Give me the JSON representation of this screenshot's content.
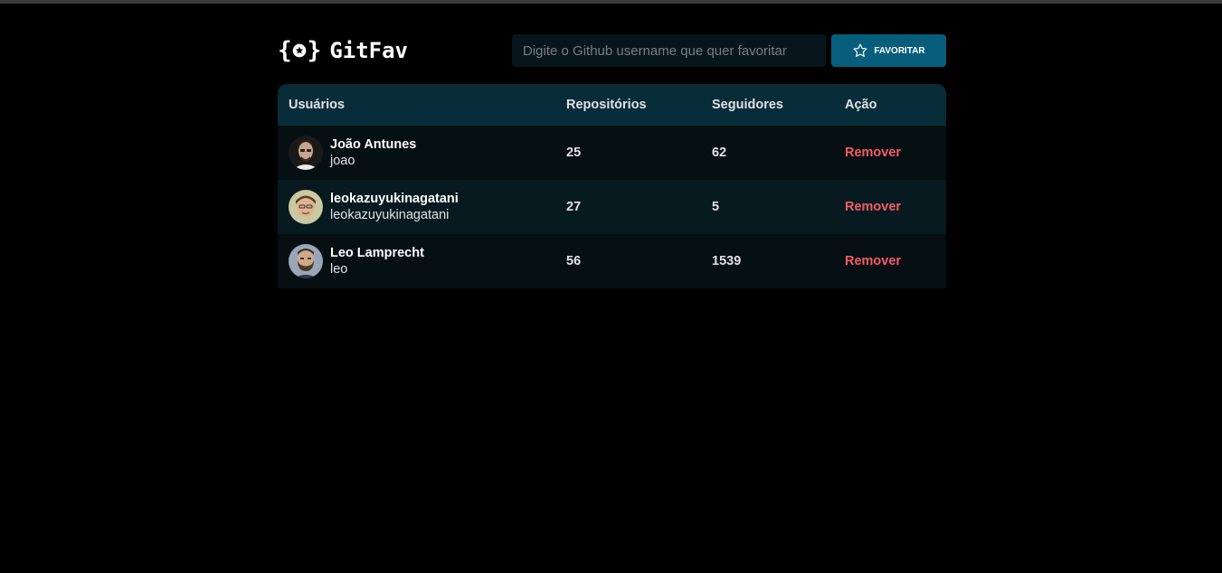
{
  "header": {
    "logo_text": "GitFav",
    "search_placeholder": "Digite o Github username que quer favoritar",
    "search_value": "",
    "favorite_button_label": "FAVORITAR"
  },
  "table": {
    "columns": [
      "Usuários",
      "Repositórios",
      "Seguidores",
      "Ação"
    ],
    "rows": [
      {
        "name": "João Antunes",
        "login": "joao",
        "repositories": "25",
        "followers": "62",
        "action": "Remover"
      },
      {
        "name": "leokazuyukinagatani",
        "login": "leokazuyukinagatani",
        "repositories": "27",
        "followers": "5",
        "action": "Remover"
      },
      {
        "name": "Leo Lamprecht",
        "login": "leo",
        "repositories": "56",
        "followers": "1539",
        "action": "Remover"
      }
    ]
  },
  "colors": {
    "background": "#000000",
    "header_row": "#092d38",
    "button": "#065e7c",
    "remove": "#f75a68"
  }
}
